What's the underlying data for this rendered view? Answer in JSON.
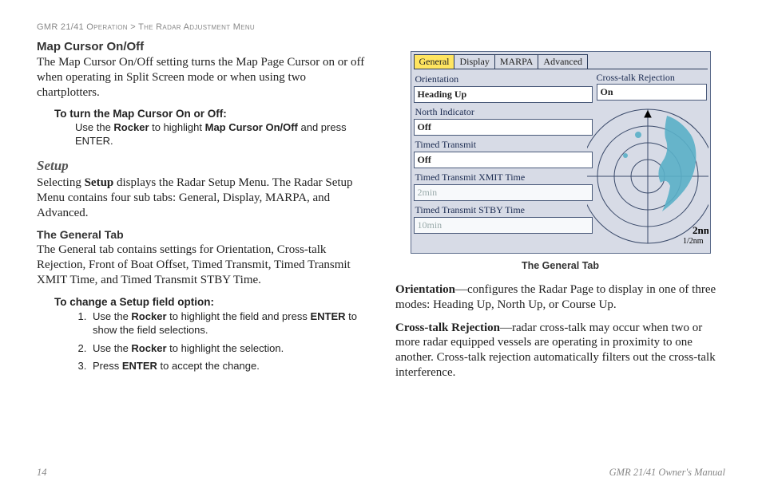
{
  "header": {
    "breadcrumb": "GMR 21/41 Operation > The Radar Adjustment Menu"
  },
  "left": {
    "h1": "Map Cursor On/Off",
    "p1": "The Map Cursor On/Off setting turns the Map Page Cursor on or off when operating in Split Screen mode or when using two chartplotters.",
    "instr1_title": "To turn the Map Cursor On or Off:",
    "instr1_pre": "Use the ",
    "instr1_b1": "Rocker",
    "instr1_mid": " to highlight ",
    "instr1_b2": "Map Cursor On/Off",
    "instr1_post": " and press ENTER.",
    "setup_h": "Setup",
    "setup_p_a": "Selecting ",
    "setup_p_b": "Setup",
    "setup_p_c": " displays the Radar Setup Menu. The Radar Setup Menu contains four sub tabs: General, Display, MARPA, and Advanced.",
    "gentab_h": "The General Tab",
    "gentab_p": "The General tab contains settings for Orientation, Cross-talk Rejection, Front of Boat Offset, Timed Transmit, Timed Transmit XMIT Time, and Timed Transmit STBY Time.",
    "change_h": "To change a Setup field option:",
    "steps": {
      "s1a": "Use the ",
      "s1b": "Rocker",
      "s1c": " to highlight the field and press ",
      "s1d": "ENTER",
      "s1e": " to show the field selections.",
      "s2a": "Use the ",
      "s2b": "Rocker",
      "s2c": " to highlight the selection.",
      "s3a": "Press ",
      "s3b": "ENTER",
      "s3c": " to accept the change."
    }
  },
  "shot": {
    "tabs": {
      "general": "General",
      "display": "Display",
      "marpa": "MARPA",
      "advanced": "Advanced"
    },
    "orientation_label": "Orientation",
    "orientation_value": "Heading Up",
    "north_label": "North Indicator",
    "north_value": "Off",
    "tt_label": "Timed Transmit",
    "tt_value": "Off",
    "xmit_label": "Timed Transmit XMIT Time",
    "xmit_value": "2min",
    "stby_label": "Timed Transmit STBY Time",
    "stby_value": "10min",
    "ctr_label": "Cross-talk Rejection",
    "ctr_value": "On",
    "range_big": "2nm",
    "range_small": "1/2nm",
    "caption": "The General Tab"
  },
  "right": {
    "orient_b": "Orientation",
    "orient_t": "—configures the Radar Page to display in one of three modes: Heading Up, North Up, or Course Up.",
    "ctr_b": "Cross-talk Rejection",
    "ctr_t": "—radar cross-talk may occur when two or more radar equipped vessels are operating in proximity to one another. Cross-talk rejection automatically filters out the cross-talk interference."
  },
  "footer": {
    "page": "14",
    "title": "GMR 21/41 Owner's Manual"
  }
}
